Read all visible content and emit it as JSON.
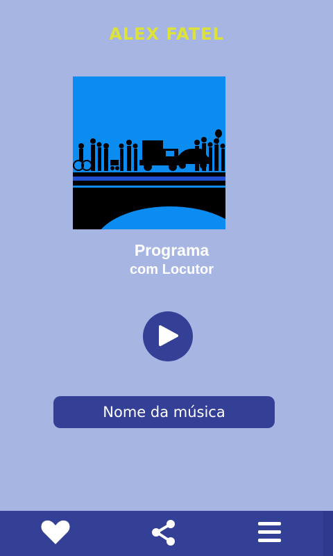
{
  "header": {
    "title": "ALEX FATEL"
  },
  "player": {
    "cover_icon": "city-bridge-silhouette-artwork",
    "program_title": "Programa",
    "program_subtitle": "com Locutor",
    "play_icon": "play-icon",
    "song_name": "Nome da música"
  },
  "bottom_nav": {
    "items": [
      {
        "icon": "heart-icon"
      },
      {
        "icon": "share-icon"
      },
      {
        "icon": "menu-icon"
      }
    ]
  },
  "colors": {
    "background": "#a7b5e3",
    "accent": "#343f96",
    "title": "#dde23a",
    "cover_blue": "#0a8cf0"
  }
}
